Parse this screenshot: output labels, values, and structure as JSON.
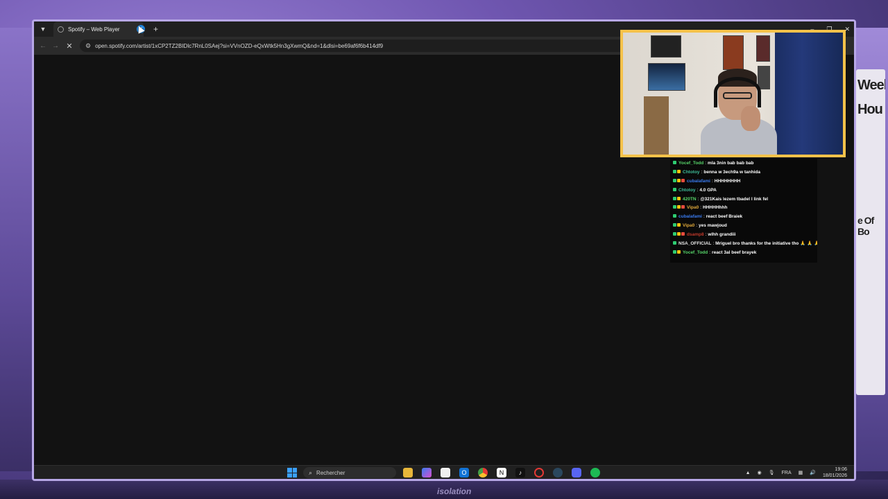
{
  "browser": {
    "tab_title": "Spotify – Web Player",
    "new_tab": "+",
    "url": "open.spotify.com/artist/1xCP2TZ2BIDlc7RnL0SAej?si=VVnOZD-eQxWtk5Hn3gXwmQ&nd=1&dlsi=be69af6f6b414df9",
    "window_controls": [
      "–",
      "❐",
      "✕"
    ]
  },
  "taskbar": {
    "search_placeholder": "Rechercher",
    "language": "FRA",
    "time": "19:06",
    "date": "18/01/2026",
    "apps": [
      "files-icon",
      "copilot-icon",
      "store-icon",
      "outlook-icon",
      "chrome-icon",
      "notion-icon",
      "capcut-icon",
      "opera-icon",
      "steam-icon",
      "discord-icon",
      "spotify-icon"
    ]
  },
  "chat": {
    "messages": [
      {
        "user": "Yocef_Todd",
        "color": "#57d66a",
        "text": "mla 3nin bab bab bab"
      },
      {
        "user": "Chtotoy",
        "color": "#3fbf9a",
        "text": "benna w 3ech9a w tanhida"
      },
      {
        "user": "cubalafami",
        "color": "#3a7bf0",
        "text": "HHHHHHHH"
      },
      {
        "user": "Chtotoy",
        "color": "#3fbf9a",
        "text": "4.0 GPA"
      },
      {
        "user": "420TN",
        "color": "#57d66a",
        "text": "@321Kais lezem tbadel l link fel"
      },
      {
        "user": "Vipa0",
        "color": "#e0a93b",
        "text": "HHHHHhhh"
      },
      {
        "user": "cubalafami",
        "color": "#3a7bf0",
        "text": "react beef Braiek"
      },
      {
        "user": "Vipa0",
        "color": "#e0a93b",
        "text": "yes mawjoud"
      },
      {
        "user": "dsamp8",
        "color": "#c0392b",
        "text": "wlhh grandiii"
      },
      {
        "user": "NSA_OFFICIAL",
        "color": "#e8e8e8",
        "text": "Mriguel bro thanks for the initiative tho 🙏 🙏 🙏"
      },
      {
        "user": "Yocef_Todd",
        "color": "#57d66a",
        "text": "react 3al beef brayek"
      }
    ]
  },
  "stream": {
    "floor_logo": "isolation",
    "poster_text": [
      "Week",
      "Hou",
      "e Of Bo"
    ]
  }
}
